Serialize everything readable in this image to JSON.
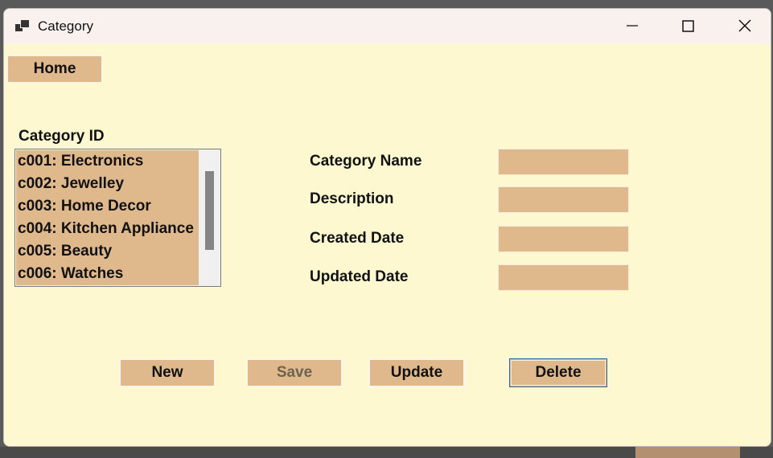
{
  "window": {
    "title": "Category"
  },
  "toolbar": {
    "home_label": "Home"
  },
  "category_list": {
    "label": "Category ID",
    "items": [
      "c001: Electronics",
      "c002: Jewelley",
      "c003: Home Decor",
      "c004: Kitchen Appliance",
      "c005: Beauty",
      "c006: Watches"
    ]
  },
  "form": {
    "category_name_label": "Category Name",
    "description_label": "Description",
    "created_date_label": "Created Date",
    "updated_date_label": "Updated Date",
    "category_name_value": "",
    "description_value": "",
    "created_date_value": "",
    "updated_date_value": ""
  },
  "actions": {
    "new_label": "New",
    "save_label": "Save",
    "update_label": "Update",
    "delete_label": "Delete"
  },
  "colors": {
    "background": "#fdf8d0",
    "control": "#dfb98c",
    "titlebar": "#f8f1ed",
    "focus_border": "#2c66a6"
  }
}
